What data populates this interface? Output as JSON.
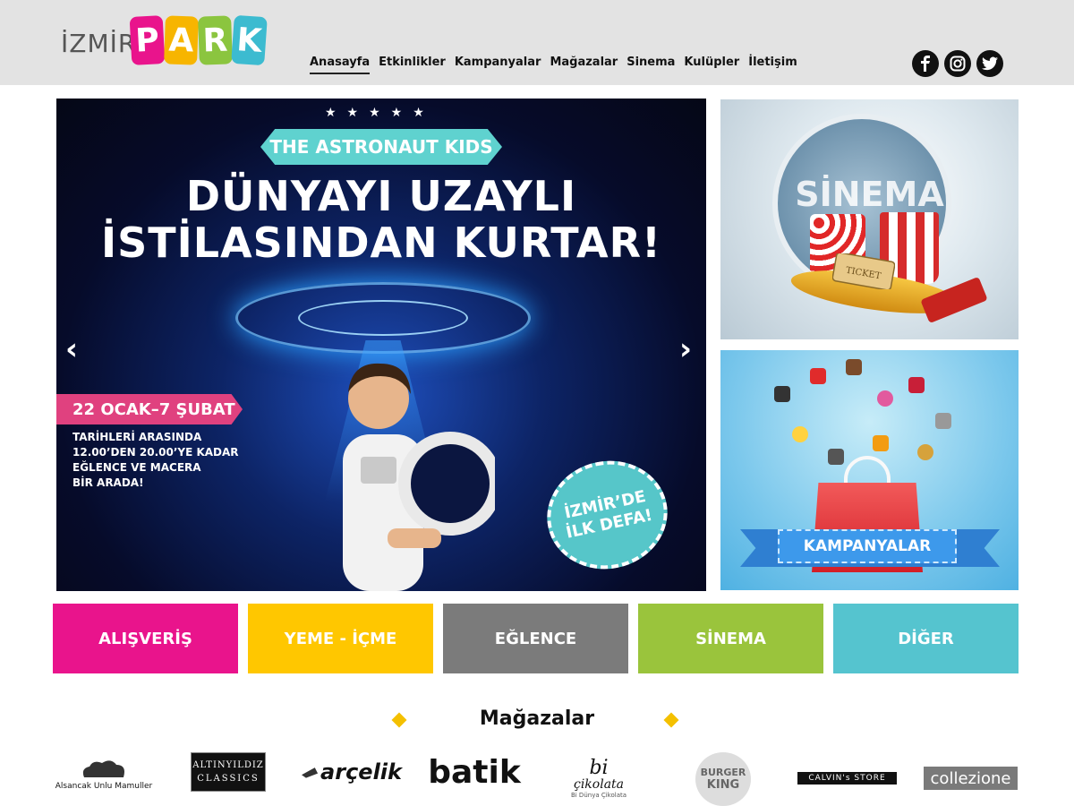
{
  "header": {
    "logo": {
      "izmir": "İZMİR",
      "park_letters": [
        "P",
        "A",
        "R",
        "K"
      ]
    },
    "nav": [
      {
        "label": "Anasayfa",
        "active": true
      },
      {
        "label": "Etkinlikler"
      },
      {
        "label": "Kampanyalar"
      },
      {
        "label": "Mağazalar"
      },
      {
        "label": "Sinema"
      },
      {
        "label": "Kulüpler"
      },
      {
        "label": "İletişim"
      }
    ],
    "social": [
      "facebook-icon",
      "instagram-icon",
      "twitter-icon"
    ]
  },
  "hero": {
    "ribbon": "THE ASTRONAUT KIDS",
    "headline_line1": "DÜNYAYI UZAYLI",
    "headline_line2": "İSTİLASINDAN KURTAR!",
    "date": "22 OCAK–7 ŞUBAT",
    "desc": [
      "TARİHLERİ ARASINDA",
      "12.00’DEN 20.00’YE KADAR",
      "EĞLENCE VE MACERA",
      "BİR ARADA!"
    ],
    "badge": [
      "İZMİR’DE",
      "İLK DEFA!"
    ],
    "prev_arrow": "‹",
    "next_arrow": "›"
  },
  "promos": {
    "sinema_title": "SİNEMA",
    "ticket_text": "TICKET",
    "kampanya_title": "KAMPANYALAR"
  },
  "categories": [
    {
      "label": "ALIŞVERİŞ",
      "color": "#e9148c"
    },
    {
      "label": "YEME - İÇME",
      "color": "#ffc700"
    },
    {
      "label": "EĞLENCE",
      "color": "#7b7b7b"
    },
    {
      "label": "SİNEMA",
      "color": "#9ac43c"
    },
    {
      "label": "DİĞER",
      "color": "#55c4cf"
    }
  ],
  "stores": {
    "title": "Mağazalar",
    "brands": [
      {
        "name": "Alsancak Unlu Mamuller"
      },
      {
        "line1": "ALTINYILDIZ",
        "line2": "CLASSICS"
      },
      {
        "name": "arçelik"
      },
      {
        "name": "batik"
      },
      {
        "line1": "bi",
        "line2": "çikolata",
        "line3": "Bi Dünya Çikolata"
      },
      {
        "line1": "BURGER",
        "line2": "KING"
      },
      {
        "name": "CALVIN's STORE"
      },
      {
        "name": "collezione"
      }
    ]
  }
}
